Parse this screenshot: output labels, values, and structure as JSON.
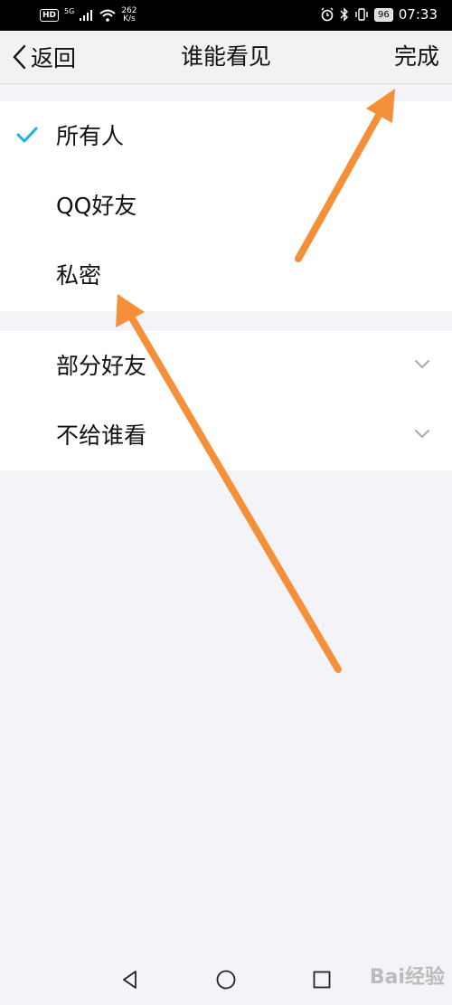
{
  "status_bar": {
    "hd": "HD",
    "net": "5G",
    "speed_value": "262",
    "speed_unit": "K/s",
    "battery": "96",
    "time": "07:33"
  },
  "nav": {
    "back_label": "返回",
    "title": "谁能看见",
    "done_label": "完成"
  },
  "options": [
    {
      "label": "所有人",
      "selected": true
    },
    {
      "label": "QQ好友",
      "selected": false
    },
    {
      "label": "私密",
      "selected": false
    }
  ],
  "expandable_options": [
    {
      "label": "部分好友"
    },
    {
      "label": "不给谁看"
    }
  ],
  "colors": {
    "accent": "#1ab0e8",
    "annotation_arrow": "#f5903a"
  },
  "watermark": "Bai经验"
}
